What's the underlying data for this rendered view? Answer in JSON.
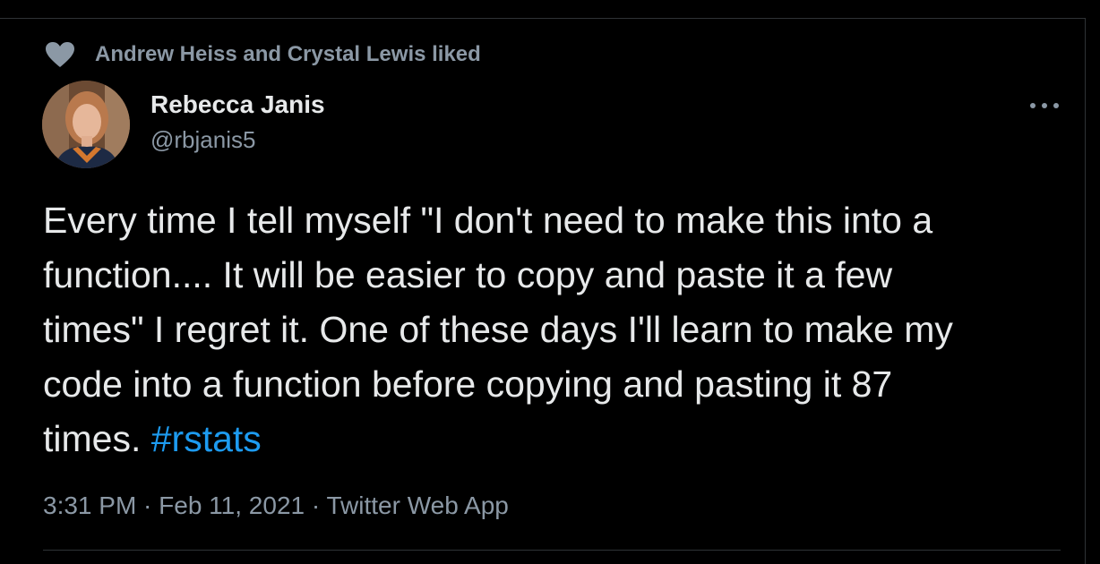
{
  "social_context": {
    "icon": "heart-icon",
    "text": "Andrew Heiss and Crystal Lewis liked"
  },
  "author": {
    "display_name": "Rebecca Janis",
    "handle": "@rbjanis5",
    "avatar": "avatar"
  },
  "tweet": {
    "text_lines": [
      "Every time I tell myself \"I don't need to make this into a",
      "function.... It will be easier to copy and paste it a few",
      "times\" I regret it. One of these days I'll learn to make my",
      "code into a function before copying and pasting it 87",
      "times. "
    ],
    "hashtag": "#rstats"
  },
  "meta": {
    "text": "3:31 PM · Feb 11, 2021 · Twitter Web App"
  },
  "colors": {
    "background": "#000000",
    "text": "#e7e9ea",
    "muted": "#8b98a5",
    "link": "#1d9bf0",
    "border": "#2f3336"
  }
}
